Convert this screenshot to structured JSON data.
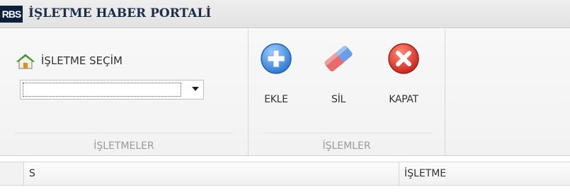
{
  "window": {
    "app_icon_text": "RBS",
    "title": "İŞLETME HABER PORTALİ"
  },
  "ribbon": {
    "groups": [
      {
        "caption": "İŞLETMELER",
        "selector": {
          "label": "İŞLETME SEÇİM",
          "icon": "house-icon",
          "value": ""
        }
      },
      {
        "caption": "İŞLEMLER",
        "buttons": [
          {
            "label": "EKLE",
            "icon": "plus-circle-icon",
            "color": "#3a86d9"
          },
          {
            "label": "SİL",
            "icon": "eraser-icon",
            "color": "#e45a5a"
          },
          {
            "label": "KAPAT",
            "icon": "close-circle-icon",
            "color": "#d9342b"
          }
        ]
      }
    ]
  },
  "grid": {
    "columns": [
      "S",
      "İŞLETME"
    ]
  }
}
